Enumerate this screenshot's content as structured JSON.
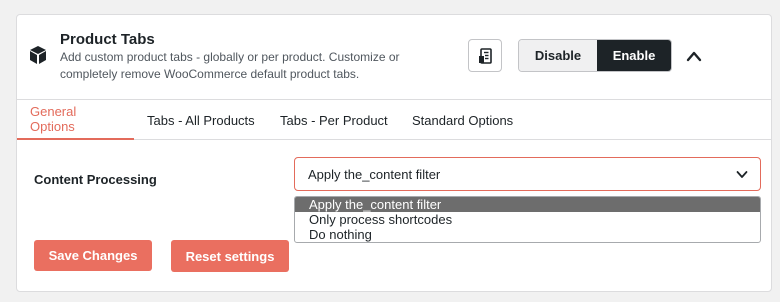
{
  "header": {
    "title": "Product Tabs",
    "description": "Add custom product tabs - globally or per product. Customize or completely remove WooCommerce default product tabs.",
    "icon": "cube-icon",
    "doc_icon": "document-icon",
    "collapse_icon": "chevron-up-icon"
  },
  "toggle": {
    "disable_label": "Disable",
    "enable_label": "Enable",
    "active": "Enable"
  },
  "tabs": [
    {
      "label": "General Options",
      "active": true
    },
    {
      "label": "Tabs - All Products",
      "active": false
    },
    {
      "label": "Tabs - Per Product",
      "active": false
    },
    {
      "label": "Standard Options",
      "active": false
    }
  ],
  "form": {
    "content_processing": {
      "label": "Content Processing",
      "value": "Apply the_content filter",
      "options": [
        "Apply the_content filter",
        "Only process shortcodes",
        "Do nothing"
      ],
      "highlighted_option": "Apply the_content filter"
    }
  },
  "buttons": {
    "save_label": "Save Changes",
    "reset_label": "Reset settings"
  },
  "colors": {
    "accent": "#e36b5b",
    "button": "#ea6f60",
    "dark": "#1d2327"
  }
}
